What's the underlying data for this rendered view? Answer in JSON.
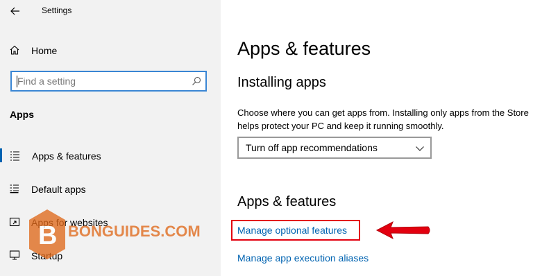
{
  "window": {
    "title": "Settings"
  },
  "sidebar": {
    "home_label": "Home",
    "search_placeholder": "Find a setting",
    "section_label": "Apps",
    "items": [
      {
        "label": "Apps & features",
        "icon": "list-icon",
        "active": true
      },
      {
        "label": "Default apps",
        "icon": "default-apps-icon",
        "active": false
      },
      {
        "label": "Apps for websites",
        "icon": "apps-for-websites-icon",
        "active": false
      },
      {
        "label": "Startup",
        "icon": "startup-icon",
        "active": false
      }
    ]
  },
  "main": {
    "title": "Apps & features",
    "installing": {
      "heading": "Installing apps",
      "description": "Choose where you can get apps from. Installing only apps from the Store helps protect your PC and keep it running smoothly.",
      "dropdown_value": "Turn off app recommendations"
    },
    "apps_features": {
      "heading": "Apps & features",
      "links": [
        "Manage optional features",
        "Manage app execution aliases"
      ]
    }
  },
  "watermark": {
    "text": "BONGUIDES.COM",
    "logo_letter": "B"
  },
  "colors": {
    "accent": "#0063b1",
    "highlight": "#e3000f",
    "sidebar_bg": "#f2f2f2"
  }
}
